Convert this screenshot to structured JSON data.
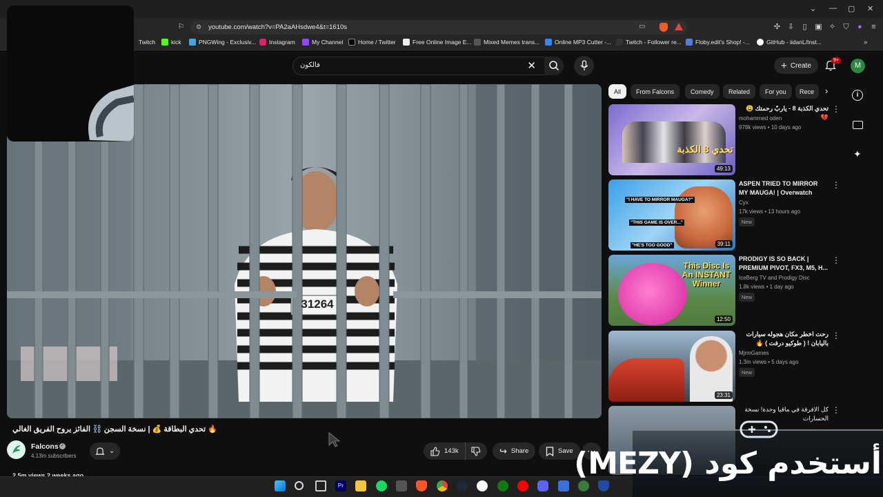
{
  "browser": {
    "url": "youtube.com/watch?v=PA2aAHsdwe4&t=1610s",
    "bookmarks": [
      "Twitch",
      "kick",
      "PNGWing - Exclusiv...",
      "Instagram",
      "My Channel",
      "Home / Twitter",
      "Free Online Image E...",
      "Mixed Memes trans...",
      "Online MP3 Cutter -...",
      "Twitch - Follower re...",
      "Floby.edit's Shop! -...",
      "GitHub - iidanL/Inst..."
    ]
  },
  "header": {
    "search_value": "فالكون",
    "create_label": "Create",
    "notif_count": "9+",
    "avatar_letter": "M"
  },
  "player": {
    "shirt_number": "31264"
  },
  "chips": [
    "All",
    "From Falcons",
    "Comedy",
    "Related",
    "For you",
    "Recе"
  ],
  "video": {
    "title": "🔥 تحدي البطاقة 💰 | نسخة السجن ⛓️ الفائز يروح الفريق الغالي",
    "channel": "Falcons",
    "subscribers": "4.13m subscribers",
    "likes": "143k",
    "share_label": "Share",
    "save_label": "Save",
    "views_partial": "2.5m views 2 weeks ago"
  },
  "recommendations": [
    {
      "title": "تحدي الكذبة 8 - ياربّ رحمتك 😩💔",
      "channel": "mohammed oden",
      "meta": "978k views • 10 days ago",
      "duration": "49:13",
      "thumb_text": "تحدي 8 الكذبة",
      "new": ""
    },
    {
      "title": "ASPEN TRIED TO MIRROR MY MAUGA! | Overwatch",
      "channel": "Cyx",
      "meta": "17k views • 13 hours ago",
      "duration": "39:11",
      "thumb_text": "\"I HAVE TO MIRROR MAUGA?\"",
      "thumb_text2": "\"THIS GAME IS OVER...\"",
      "thumb_text3": "\"HE'S TOO GOOD\"",
      "new": "New"
    },
    {
      "title": "PRODIGY IS SO BACK | PREMIUM PIVOT, FX3, M5, H...",
      "channel": "IceBerg TV and Prodigy Disc",
      "meta": "1.8k views • 1 day ago",
      "duration": "12:50",
      "thumb_text": "This Disc Is An INSTANT Winner",
      "new": "New"
    },
    {
      "title": "رحت اخطر مكان هجوله سيارات باليابان ! ( طوكيو درفت ) 🔥",
      "channel": "MjrmGames",
      "meta": "1.3m views • 5 days ago",
      "duration": "23:31",
      "new": "New"
    },
    {
      "title": "كل الافرقة في ماقيا وحدة! نسخة الحسارات",
      "channel": "",
      "meta": "",
      "duration": "",
      "new": ""
    }
  ],
  "overlay": {
    "text": "أستخدم كود (MEZY)"
  }
}
